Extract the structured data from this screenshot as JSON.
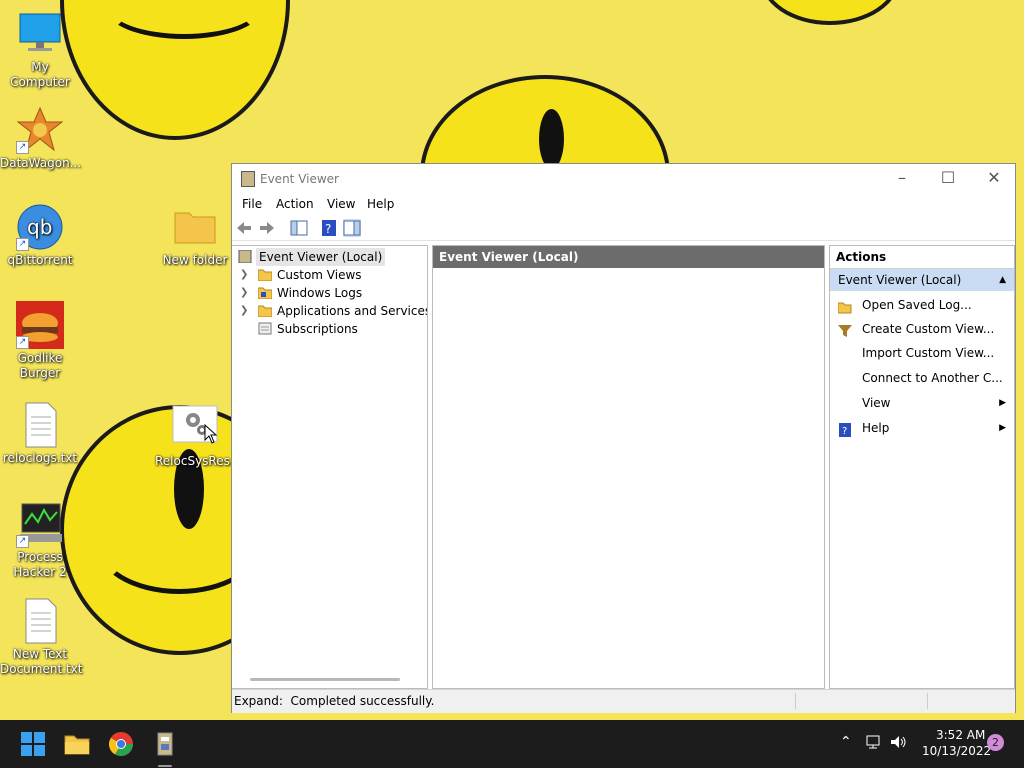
{
  "desktop": {
    "icons": [
      {
        "label": "My Computer"
      },
      {
        "label": "DataWagon..."
      },
      {
        "label": "qBittorrent"
      },
      {
        "label": "Godlike Burger"
      },
      {
        "label": "reloclogs.txt"
      },
      {
        "label": "Process Hacker 2"
      },
      {
        "label": "New Text Document.txt"
      },
      {
        "label": "New folder"
      },
      {
        "label": "RelocSysRes..."
      }
    ]
  },
  "window": {
    "title": "Event Viewer",
    "menu": [
      "File",
      "Action",
      "View",
      "Help"
    ],
    "tree": [
      {
        "label": "Event Viewer (Local)"
      },
      {
        "label": "Custom Views"
      },
      {
        "label": "Windows Logs"
      },
      {
        "label": "Applications and Services Lo"
      },
      {
        "label": "Subscriptions"
      }
    ],
    "center_header": "Event Viewer (Local)",
    "actions": {
      "header": "Actions",
      "section": "Event Viewer (Local)",
      "items": [
        {
          "label": "Open Saved Log..."
        },
        {
          "label": "Create Custom View..."
        },
        {
          "label": "Import Custom View..."
        },
        {
          "label": "Connect to Another C..."
        },
        {
          "label": "View"
        },
        {
          "label": "Help"
        }
      ]
    },
    "status": "Expand:  Completed successfully."
  },
  "taskbar": {
    "time": "3:52 AM",
    "date": "10/13/2022",
    "notifications": "2"
  },
  "colors": {
    "desktop_bg": "#f3e45a",
    "actions_section_bg": "#c9dcf3",
    "center_header_bg": "#6c6c6c",
    "taskbar_bg": "#1c1c1c"
  }
}
